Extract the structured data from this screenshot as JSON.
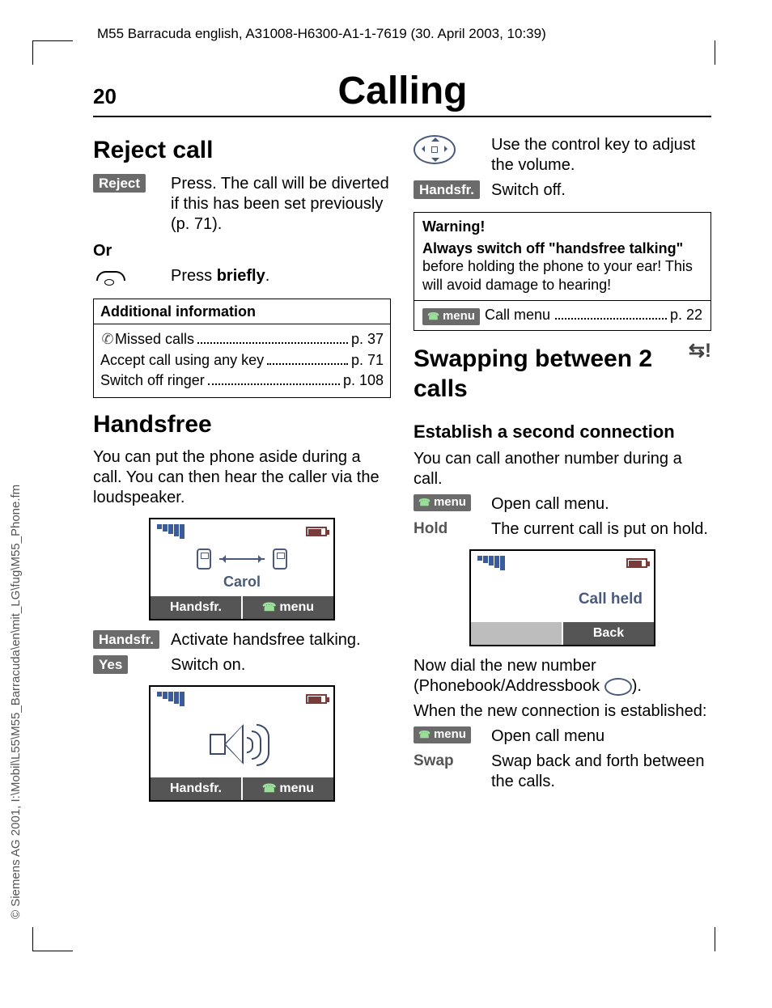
{
  "header": "M55 Barracuda english, A31008-H6300-A1-1-7619 (30. April 2003, 10:39)",
  "side": "© Siemens AG 2001, I:\\Mobil\\L55\\M55_Barracuda\\en\\mit_LG\\fug\\M55_Phone.fm",
  "pagenum": "20",
  "title": "Calling",
  "left": {
    "h_reject": "Reject call",
    "reject_key": "Reject",
    "reject_desc": "Press. The call will be diverted if this has been set previously (p. 71).",
    "or": "Or",
    "press_briefly_pre": "Press ",
    "press_briefly_b": "briefly",
    "press_briefly_post": ".",
    "info_title": "Additional information",
    "info1_text": "Missed calls",
    "info1_page": "p. 37",
    "info2_text": "Accept call using any key",
    "info2_page": "p. 71",
    "info3_text": "Switch off ringer",
    "info3_page": "p. 108",
    "h_handsfree": "Handsfree",
    "hf_intro": "You can put the phone aside during a call. You can then hear the caller via the loudspeaker.",
    "screen1_name": "Carol",
    "screen_soft_left": "Handsfr.",
    "screen_soft_right": "menu",
    "hf_key": "Handsfr.",
    "hf_desc": "Activate handsfree talking.",
    "yes_key": "Yes",
    "yes_desc": "Switch on."
  },
  "right": {
    "vol_desc": "Use the control key to adjust the volume.",
    "hf_key": "Handsfr.",
    "hf_off": "Switch off.",
    "warn_title": "Warning!",
    "warn_bold": "Always switch off \"handsfree talking\"",
    "warn_rest": " before holding the phone to your ear! This will avoid damage to hearing!",
    "warn_menu_key": "menu",
    "warn_menu_text": "Call menu",
    "warn_menu_page": "p. 22",
    "h_swap": "Swapping between 2 calls",
    "h_est": "Establish a second connection",
    "est_intro": "You can call another number during a call.",
    "menu_key": "menu",
    "open_menu": "Open call menu.",
    "hold_key": "Hold",
    "hold_desc": "The current call is put on hold.",
    "screen_status": "Call held",
    "screen_back": "Back",
    "dial_new": "Now dial the new number (Phonebook/Addressbook ",
    "dial_new_post": ").",
    "when_est": "When the new connection is established:",
    "open_menu2": "Open call menu",
    "swap_key": "Swap",
    "swap_desc": "Swap back and forth between the calls."
  }
}
